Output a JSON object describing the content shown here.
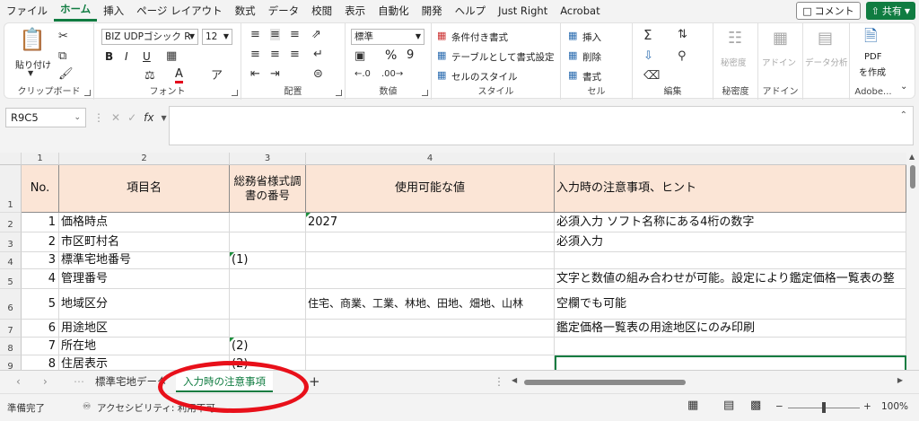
{
  "menu": {
    "tabs": [
      "ファイル",
      "ホーム",
      "挿入",
      "ページ レイアウト",
      "数式",
      "データ",
      "校閲",
      "表示",
      "自動化",
      "開発",
      "ヘルプ",
      "Just Right",
      "Acrobat"
    ],
    "active_tab": "ホーム",
    "comment_label": "コメント",
    "share_label": "共有"
  },
  "ribbon": {
    "clipboard": {
      "paste": "貼り付け",
      "label": "クリップボード"
    },
    "font": {
      "family": "BIZ UDPゴシック R",
      "size": "12",
      "bold": "B",
      "italic": "I",
      "underline": "U",
      "font_color_glyph": "A",
      "inc": "A^",
      "dec": "Aˇ",
      "label": "フォント"
    },
    "alignment": {
      "label": "配置"
    },
    "number": {
      "format": "標準",
      "percent": "%",
      "comma": "9",
      "label": "数値"
    },
    "styles": {
      "conditional": "条件付き書式",
      "table": "テーブルとして書式設定",
      "cell_style": "セルのスタイル",
      "label": "スタイル"
    },
    "cells": {
      "insert": "挿入",
      "delete": "削除",
      "format": "書式",
      "label": "セル"
    },
    "editing": {
      "label": "編集"
    },
    "sensitivity": {
      "btn": "秘密度",
      "label": "秘密度"
    },
    "addin": {
      "btn": "アドイン",
      "label": "アドイン"
    },
    "analyze": {
      "btn": "データ分析"
    },
    "adobe": {
      "btn_line1": "PDF",
      "btn_line2": "を作成",
      "label": "Adobe..."
    }
  },
  "formula_bar": {
    "name_box": "R9C5",
    "fx": "fx",
    "content": ""
  },
  "columns": [
    {
      "label": "1"
    },
    {
      "label": "2"
    },
    {
      "label": "3"
    },
    {
      "label": "4"
    }
  ],
  "table": {
    "header": {
      "no": "No.",
      "item": "項目名",
      "code": "総務省様式調書の番号",
      "values": "使用可能な値",
      "notes": "入力時の注意事項、ヒント"
    },
    "rows": [
      {
        "row": "2",
        "no": "1",
        "item": "価格時点",
        "code": "",
        "values": "2027",
        "notes": "必須入力 ソフト名称にある4桁の数字"
      },
      {
        "row": "3",
        "no": "2",
        "item": "市区町村名",
        "code": "",
        "values": "",
        "notes": "必須入力"
      },
      {
        "row": "4",
        "no": "3",
        "item": "標準宅地番号",
        "code": "(1)",
        "values": "",
        "notes": ""
      },
      {
        "row": "5",
        "no": "4",
        "item": "管理番号",
        "code": "",
        "values": "",
        "notes": "文字と数値の組み合わせが可能。設定により鑑定価格一覧表の整"
      },
      {
        "row": "6",
        "no": "5",
        "item": "地域区分",
        "code": "",
        "values": "住宅、商業、工業、林地、田地、畑地、山林",
        "notes": "空欄でも可能"
      },
      {
        "row": "7",
        "no": "6",
        "item": "用途地区",
        "code": "",
        "values": "",
        "notes": "鑑定価格一覧表の用途地区にのみ印刷"
      },
      {
        "row": "8",
        "no": "7",
        "item": "所在地",
        "code": "(2)",
        "values": "",
        "notes": ""
      },
      {
        "row": "9",
        "no": "8",
        "item": "住居表示",
        "code": "(2)",
        "values": "",
        "notes": ""
      }
    ]
  },
  "sheets": {
    "tab1": "標準宅地データ",
    "tab2": "入力時の注意事項",
    "add": "+"
  },
  "status": {
    "ready": "準備完了",
    "accessibility": "アクセシビリティ: 利用不可",
    "zoom": "100%"
  }
}
